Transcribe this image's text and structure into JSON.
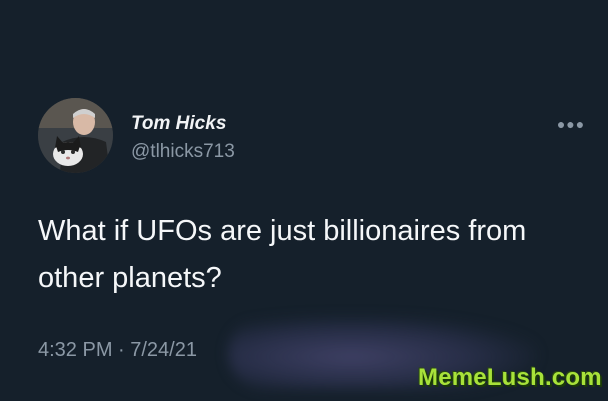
{
  "tweet": {
    "display_name": "Tom Hicks",
    "handle": "@tlhicks713",
    "more_icon": "more-icon",
    "text": "What if UFOs are just billionaires from other planets?",
    "timestamp": "4:32 PM · 7/24/21"
  },
  "watermark": {
    "text": "MemeLush.com",
    "color": "#a8e23a"
  },
  "colors": {
    "background": "#15202b",
    "primary_text": "#f5f7f9",
    "secondary_text": "#8b98a5"
  }
}
